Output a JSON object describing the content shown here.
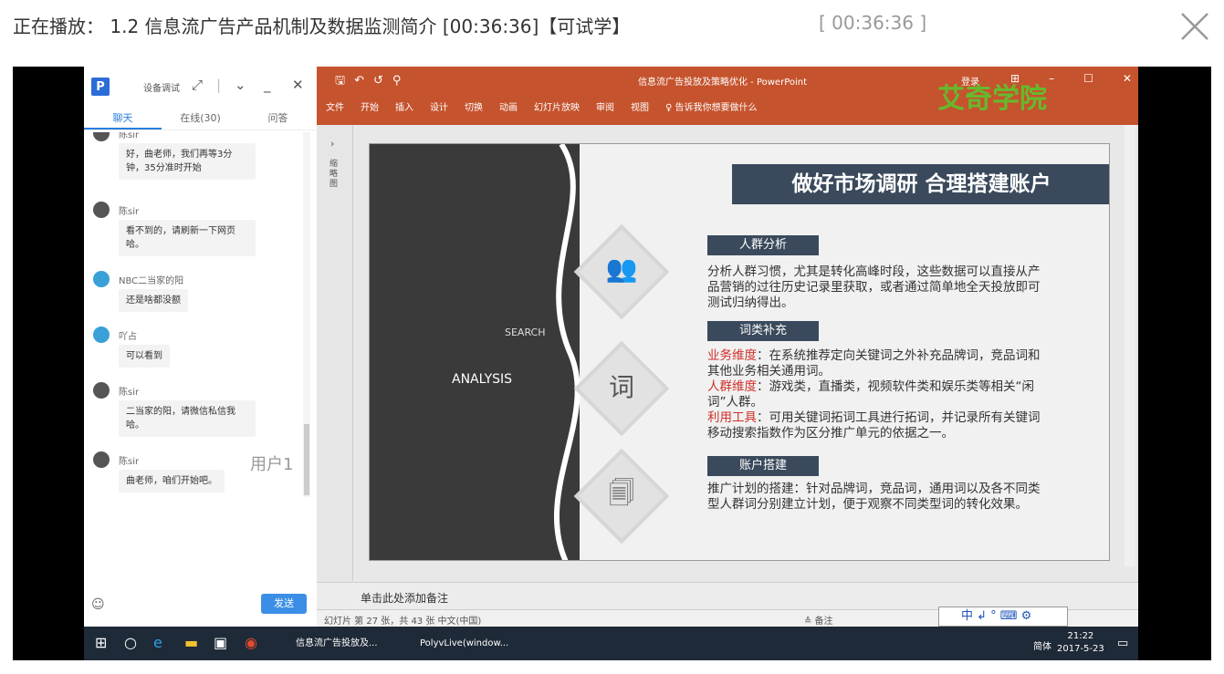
{
  "header": {
    "title": "正在播放： 1.2 信息流广告产品机制及数据监测简介 [00:36:36]【可试学】",
    "time": "[ 00:36:36 ]"
  },
  "chat": {
    "logo": "P",
    "window_title": "设备调试",
    "tabs": [
      "聊天",
      "在线(30)",
      "问答"
    ],
    "messages": [
      {
        "user": "陈sir",
        "text": "好，曲老师，我们再等3分钟，35分准时开始"
      },
      {
        "user": "陈sir",
        "text": "看不到的，请刷新一下网页哈。"
      },
      {
        "user": "NBC二当家的阳",
        "text": "还是啥都没额"
      },
      {
        "user": "吖占",
        "text": "可以看到"
      },
      {
        "user": "陈sir",
        "text": "二当家的阳，请微信私信我哈。"
      },
      {
        "user": "陈sir",
        "text": "曲老师，咱们开始吧。"
      }
    ],
    "user_label": "用户1",
    "send_label": "发送"
  },
  "ppt": {
    "window_title": "信息流广告投放及策略优化 - PowerPoint",
    "login": "登录",
    "menu": [
      "文件",
      "开始",
      "插入",
      "设计",
      "切换",
      "动画",
      "幻灯片放映",
      "审阅",
      "视图",
      "♀ 告诉我你想要做什么"
    ],
    "watermark": "艾奇学院",
    "left_pane_label": "缩略图",
    "notes_placeholder": "单击此处添加备注",
    "status_left": "幻灯片 第 27 张，共 43 张   中文(中国)",
    "status_right": "≙ 备注"
  },
  "slide": {
    "title": "做好市场调研  合理搭建账户",
    "search": "SEARCH",
    "analysis": "ANALYSIS",
    "section1_header": "人群分析",
    "section1_text": "分析人群习惯，尤其是转化高峰时段，这些数据可以直接从产品营销的过往历史记录里获取，或者通过简单地全天投放即可测试归纳得出。",
    "section2_header": "词类补充",
    "s2_k1": "业务维度",
    "s2_t1": "：在系统推荐定向关键词之外补充品牌词，竞品词和其他业务相关通用词。",
    "s2_k2": "人群维度",
    "s2_t2": "：游戏类，直播类，视频软件类和娱乐类等相关“闲词”人群。",
    "s2_k3": "利用工具",
    "s2_t3": "：可用关键词拓词工具进行拓词，并记录所有关键词移动搜索指数作为区分推广单元的依据之一。",
    "section3_header": "账户搭建",
    "section3_text": "推广计划的搭建：针对品牌词，竞品词，通用词以及各不同类型人群词分别建立计划，便于观察不同类型词的转化效果。",
    "icon_word": "词"
  },
  "taskbar": {
    "apps": [
      "信息流广告投放及...",
      "PolyvLive(window..."
    ],
    "ime": "中 ↲ ° ⌨ ⚙",
    "lang": "简体",
    "time": "21:22",
    "date": "2017-5-23"
  }
}
